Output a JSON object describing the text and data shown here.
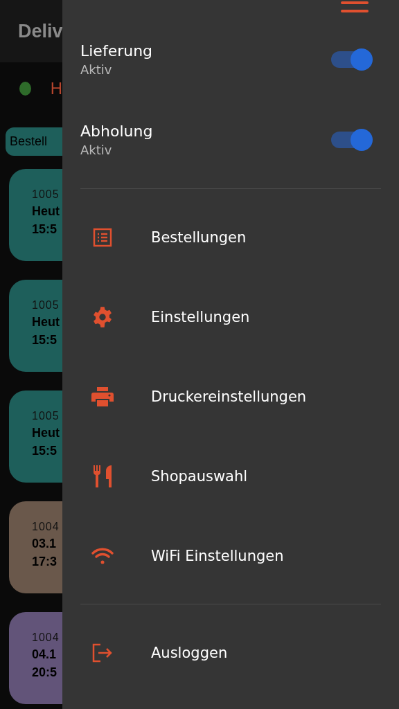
{
  "background": {
    "title": "Deliv",
    "status": {
      "color": "#2e6b2a",
      "text": "H"
    },
    "chip": "Bestell",
    "cards": [
      {
        "number": "1005",
        "day": "Heut",
        "time": "15:5",
        "color": "#1e5f5b"
      },
      {
        "number": "1005",
        "day": "Heut",
        "time": "15:5",
        "color": "#1e5f5b"
      },
      {
        "number": "1005",
        "day": "Heut",
        "time": "15:5",
        "color": "#1e5f5b"
      },
      {
        "number": "1004",
        "day": "03.1",
        "time": "17:3",
        "color": "#6a584b"
      },
      {
        "number": "1004",
        "day": "04.1",
        "time": "20:5",
        "color": "#625479"
      }
    ]
  },
  "drawer": {
    "toggles": [
      {
        "label": "Lieferung",
        "status": "Aktiv",
        "on": true
      },
      {
        "label": "Abholung",
        "status": "Aktiv",
        "on": true
      }
    ],
    "menu": [
      "Bestellungen",
      "Einstellungen",
      "Druckereinstellungen",
      "Shopauswahl",
      "WiFi Einstellungen"
    ],
    "logout": "Ausloggen"
  }
}
